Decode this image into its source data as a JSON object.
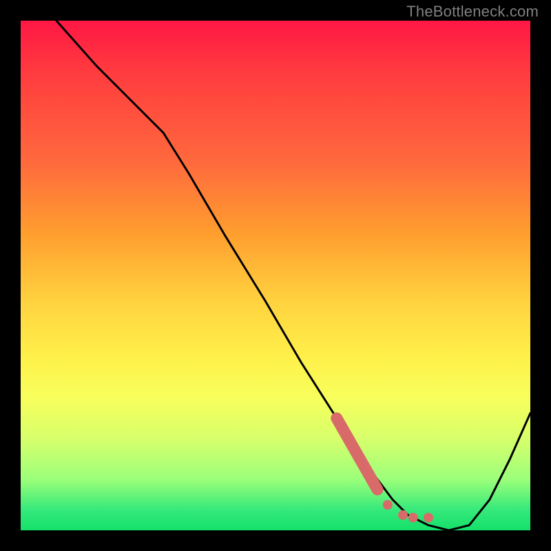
{
  "attribution": "TheBottleneck.com",
  "colors": {
    "curve": "#000000",
    "marker": "#d96a6a",
    "frame": "#000000"
  },
  "chart_data": {
    "type": "line",
    "title": "",
    "xlabel": "",
    "ylabel": "",
    "xlim": [
      0,
      100
    ],
    "ylim": [
      0,
      100
    ],
    "grid": false,
    "legend": false,
    "series": [
      {
        "name": "curve",
        "x": [
          7,
          15,
          23,
          28,
          33,
          40,
          48,
          55,
          62,
          67,
          70,
          73,
          76,
          80,
          84,
          88,
          92,
          96,
          100
        ],
        "y": [
          100,
          91,
          83,
          78,
          70,
          58,
          45,
          33,
          22,
          14,
          10,
          6,
          3,
          1,
          0,
          1,
          6,
          14,
          23
        ]
      }
    ],
    "markers": [
      {
        "name": "highlight-segment",
        "shape": "thick-line",
        "color": "#d96a6a",
        "x": [
          62,
          70
        ],
        "y": [
          22,
          8
        ]
      },
      {
        "name": "highlight-dots",
        "shape": "dots",
        "color": "#d96a6a",
        "points": [
          {
            "x": 72,
            "y": 5
          },
          {
            "x": 75,
            "y": 3
          },
          {
            "x": 77,
            "y": 2.5
          },
          {
            "x": 80,
            "y": 2.5
          }
        ]
      }
    ]
  }
}
